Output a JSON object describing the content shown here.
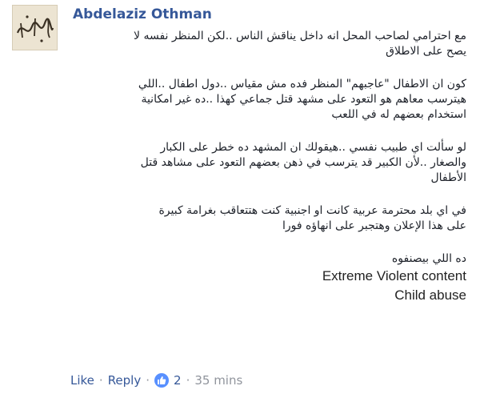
{
  "author": {
    "name": "Abdelaziz Othman"
  },
  "comment": {
    "paragraphs": [
      {
        "lines": [
          "مع احترامي لصاحب المحل انه داخل يناقش الناس ..لكن المنظر نفسه لا",
          "يصح على الاطلاق"
        ]
      },
      {
        "lines": [
          "كون ان الاطفال \"عاجبهم\" المنظر فده مش مقياس ..دول اطفال ..اللي",
          "هيترسب معاهم هو التعود على مشهد قتل جماعي كهذا ..ده غير امكانية",
          "استخدام بعضهم له في اللعب"
        ]
      },
      {
        "lines": [
          "لو سألت اي طبيب نفسي ..هيقولك ان المشهد ده خطر على الكبار",
          "والصغار ..لأن الكبير قد يترسب في ذهن بعضهم التعود على مشاهد قتل",
          "الأطفال"
        ]
      },
      {
        "lines": [
          "في اي بلد محترمة عربية كانت او اجنبية كنت هتتعاقب بغرامة كبيرة",
          "على هذا الإعلان وهتجبر على انهاؤه فورا"
        ]
      }
    ],
    "closing": {
      "arabic": "ده اللي بيصنفوه",
      "english": [
        "Extreme Violent content",
        "Child abuse"
      ]
    }
  },
  "actions": {
    "like": "Like",
    "reply": "Reply",
    "reaction_count": "2",
    "time": "35 mins",
    "separator": "·"
  },
  "colors": {
    "link": "#365899",
    "meta": "#90949c",
    "reaction": "#5890ff"
  }
}
